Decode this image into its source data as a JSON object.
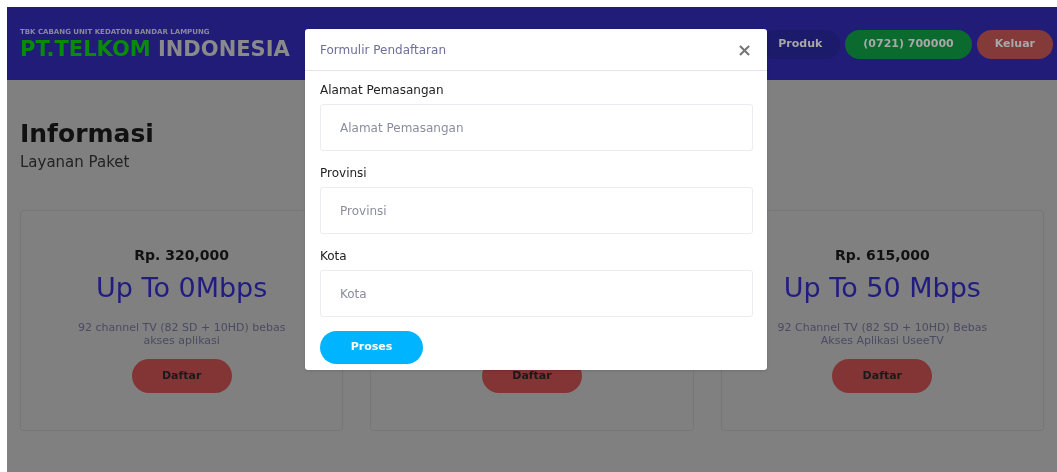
{
  "header": {
    "subtitle": "TBK CABANG UNIT KEDATON BANDAR LAMPUNG",
    "brand_primary": "PT.TELKOM",
    "brand_secondary": "INDONESIA",
    "nav_buttons": [
      {
        "label": "Produk",
        "color": "#1c1a6a"
      },
      {
        "label": "(0721) 700000",
        "color": "#0b6a2e"
      },
      {
        "label": "Keluar",
        "color": "#853a3a"
      }
    ]
  },
  "section": {
    "title": "Informasi",
    "subtitle": "Layanan Paket"
  },
  "packages": [
    {
      "price": "Rp. 320,000",
      "speed": "Up To 0Mbps",
      "description": "92 channel TV (82 SD + 10HD) bebas akses aplikasi",
      "button": "Daftar"
    },
    {
      "button": "Daftar"
    },
    {
      "price": "Rp. 615,000",
      "speed": "Up To 50 Mbps",
      "description": "92 Channel TV (82 SD + 10HD) Bebas Akses Aplikasi UseeTV",
      "button": "Daftar"
    }
  ],
  "modal": {
    "title": "Formulir Pendaftaran",
    "close": "×",
    "fields": [
      {
        "label": "Alamat Pemasangan",
        "placeholder": "Alamat Pemasangan"
      },
      {
        "label": "Provinsi",
        "placeholder": "Provinsi"
      },
      {
        "label": "Kota",
        "placeholder": "Kota"
      }
    ],
    "submit": "Proses"
  }
}
